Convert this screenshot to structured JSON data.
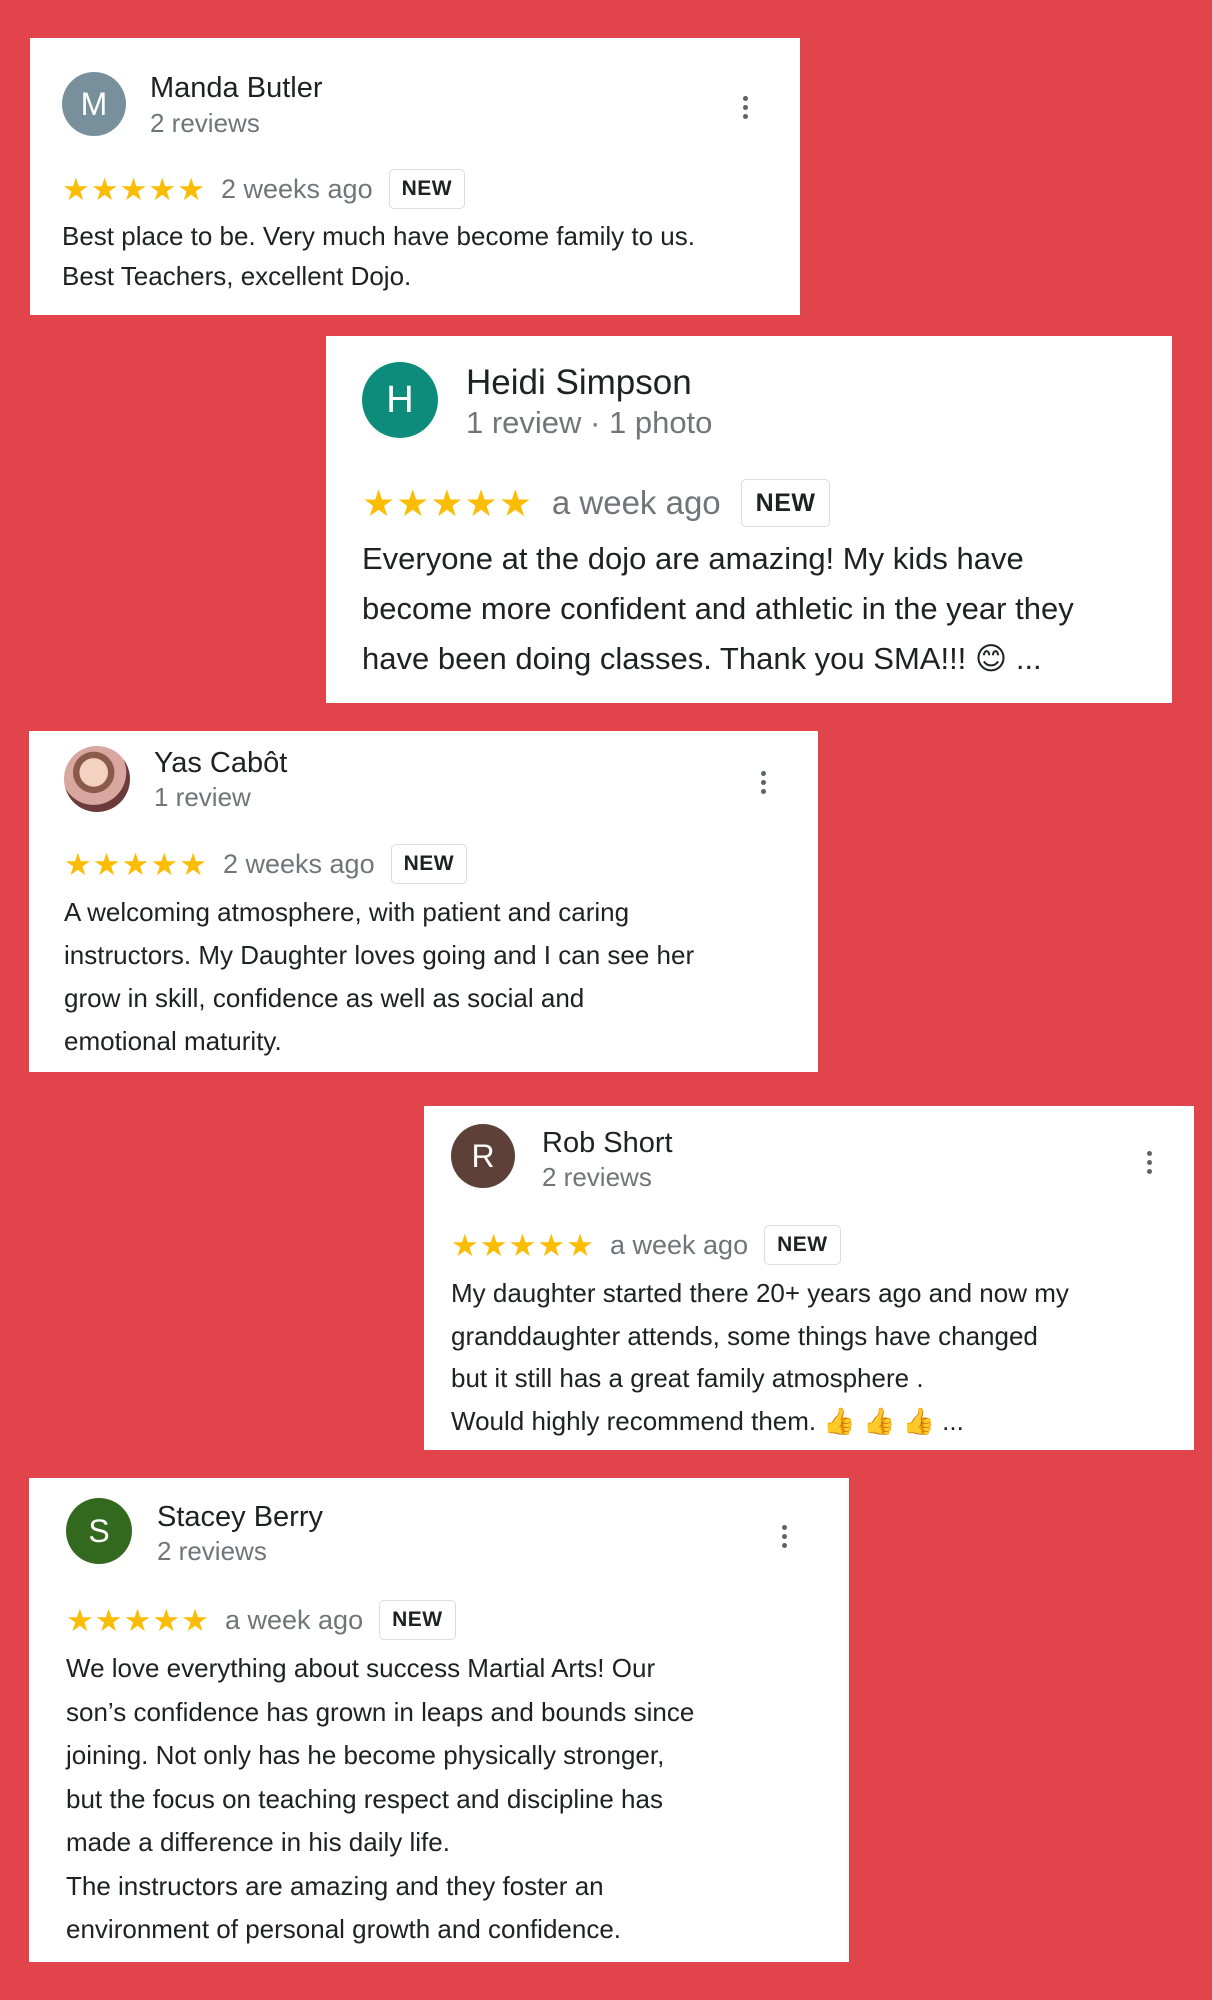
{
  "reviews": [
    {
      "avatar_letter": "M",
      "avatar_color": "#78909c",
      "name": "Manda Butler",
      "meta": "2 reviews",
      "stars": 5,
      "when": "2 weeks ago",
      "badge": "NEW",
      "text": "Best place to be. Very much have become family to us.\nBest Teachers, excellent Dojo."
    },
    {
      "avatar_letter": "H",
      "avatar_color": "#0e8c7b",
      "name": "Heidi Simpson",
      "meta": "1 review · 1 photo",
      "stars": 5,
      "when": "a week ago",
      "badge": "NEW",
      "text": "Everyone at the dojo are amazing! My kids have\nbecome more confident and athletic in the year they\nhave been doing classes. Thank you SMA!!! 😊 ..."
    },
    {
      "avatar_letter": "",
      "avatar_color": "#c98f8a",
      "name": "Yas Cabôt",
      "meta": "1 review",
      "stars": 5,
      "when": "2 weeks ago",
      "badge": "NEW",
      "text": "A welcoming atmosphere, with patient and caring\ninstructors. My Daughter loves going and I can see her\ngrow in skill, confidence as well as social and\nemotional maturity."
    },
    {
      "avatar_letter": "R",
      "avatar_color": "#5d4037",
      "name": "Rob Short",
      "meta": "2 reviews",
      "stars": 5,
      "when": "a week ago",
      "badge": "NEW",
      "text": "My daughter started there 20+ years ago and now my\ngranddaughter attends, some things have changed\nbut it still has a great family atmosphere .\nWould highly recommend them. 👍 👍 👍 ..."
    },
    {
      "avatar_letter": "S",
      "avatar_color": "#33691e",
      "name": "Stacey Berry",
      "meta": "2 reviews",
      "stars": 5,
      "when": "a week ago",
      "badge": "NEW",
      "text": "We love everything about success Martial Arts! Our\nson’s confidence has grown in leaps and bounds since\njoining. Not only has he become physically stronger,\nbut the focus on teaching respect and discipline has\nmade a difference in his daily life.\nThe instructors are amazing and they foster an\nenvironment of personal growth and confidence."
    }
  ],
  "colors": {
    "background": "#e2444b",
    "star": "#fbbc04",
    "card": "#ffffff"
  },
  "icons": {
    "star": "star-icon",
    "menu": "more-vert-icon"
  }
}
